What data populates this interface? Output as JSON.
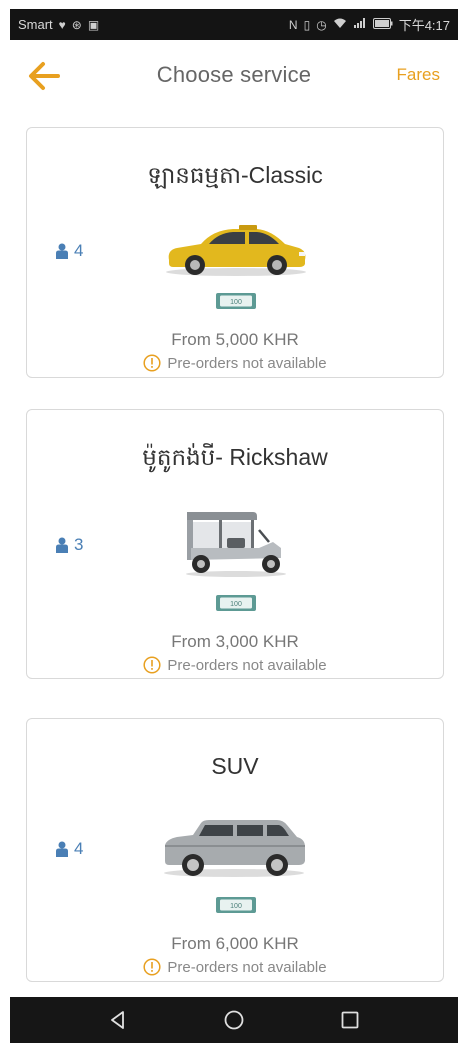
{
  "status_bar": {
    "carrier": "Smart",
    "time": "下午4:17",
    "left_icons": [
      "heart-icon",
      "weibo-icon",
      "photo-icon"
    ],
    "right_icons": [
      "nfc-icon",
      "vibrate-icon",
      "alarm-icon",
      "wifi-icon",
      "signal-icon",
      "battery-icon"
    ]
  },
  "header": {
    "title": "Choose service",
    "fares_label": "Fares",
    "accent_color": "#e8a020"
  },
  "services": [
    {
      "name": "ឡានធម្មតា-Classic",
      "seats": "4",
      "vehicle_icon": "taxi-car-icon",
      "cash_label": "100",
      "price": "From 5,000 KHR",
      "preorder": "Pre-orders not available"
    },
    {
      "name": "ម៉ូតូកង់បី- Rickshaw",
      "seats": "3",
      "vehicle_icon": "rickshaw-icon",
      "cash_label": "100",
      "price": "From 3,000 KHR",
      "preorder": "Pre-orders not available"
    },
    {
      "name": "SUV",
      "seats": "4",
      "vehicle_icon": "suv-icon",
      "cash_label": "100",
      "price": "From 6,000 KHR",
      "preorder": "Pre-orders not available"
    }
  ],
  "nav_bar": {
    "buttons": [
      "back-triangle-icon",
      "home-circle-icon",
      "recents-square-icon"
    ]
  }
}
